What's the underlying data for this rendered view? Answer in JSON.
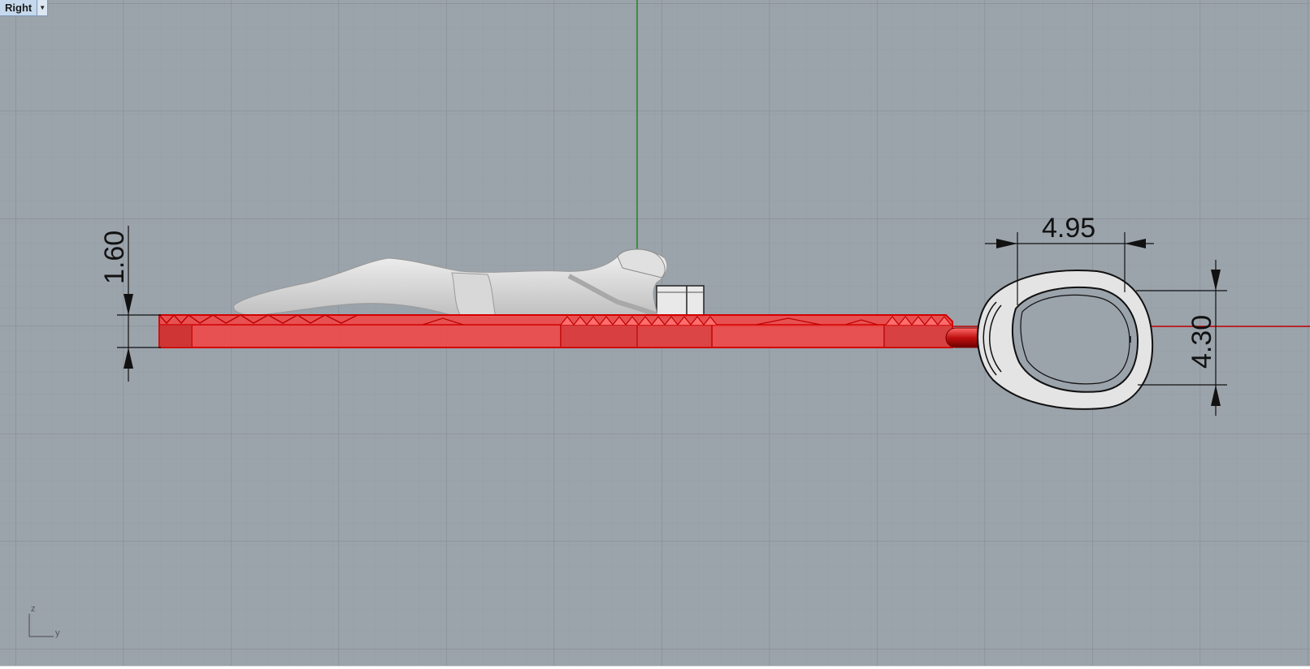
{
  "viewport": {
    "view_name": "Right",
    "view_menu_icon": "chevron-down-icon"
  },
  "dimensions": {
    "thickness": "1.60",
    "bail_width": "4.95",
    "bail_height": "4.30"
  },
  "axes": {
    "vertical": "z",
    "horizontal": "y"
  },
  "colors": {
    "background": "#9ba3ab",
    "grid_major": "#8c939b",
    "grid_minor": "#959ca4",
    "selection": "#ee3a3a",
    "x_axis": "#c00000",
    "z_axis": "#1a8a1a"
  }
}
